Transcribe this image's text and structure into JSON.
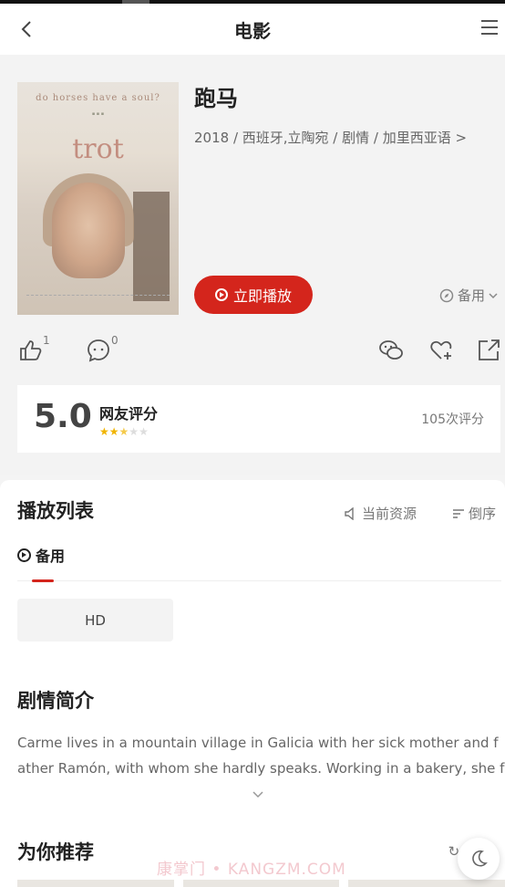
{
  "header": {
    "title": "电影",
    "back_icon": "chevron-left-icon",
    "menu_icon": "hamburger-menu-icon"
  },
  "movie": {
    "title": "跑马",
    "meta": "2018 / 西班牙,立陶宛 / 剧情 / 加里西亚语 >",
    "poster": {
      "tagline": "do horses have a soul?",
      "title": "trot"
    },
    "play_label": "立即播放",
    "backup_label": "备用"
  },
  "actions": {
    "likes": "1",
    "comments": "0"
  },
  "rating": {
    "score": "5.0",
    "label": "网友评分",
    "stars_filled": 2.5,
    "stars_total": 5,
    "count": "105次评分"
  },
  "playlist": {
    "title": "播放列表",
    "current_source": "当前资源",
    "sort": "倒序",
    "source_tab": "备用",
    "episodes": [
      "HD"
    ]
  },
  "synopsis": {
    "title": "剧情简介",
    "text": "Carme lives in a mountain village in Galicia with her sick mother and father Ramón, with whom she hardly speaks. Working in a bakery, she feels t"
  },
  "recommend": {
    "title": "为你推荐",
    "refresh": "换",
    "watermark": "康掌门 • KANGZM.COM"
  },
  "colors": {
    "accent": "#d4251c",
    "star": "#f0b400"
  }
}
